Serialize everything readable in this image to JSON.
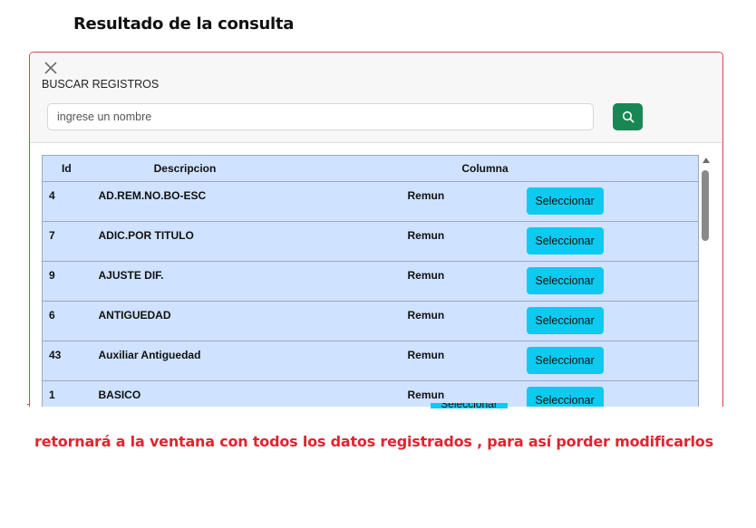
{
  "page": {
    "heading": "Resultado de la consulta",
    "footer_note": "retornará a la ventana con todos los datos registrados , para así porder modificarlos"
  },
  "modal": {
    "title": "BUSCAR REGISTROS",
    "close_icon": "close-icon",
    "search": {
      "value": "",
      "placeholder": "ingrese un nombre",
      "button_icon": "search-icon"
    },
    "table": {
      "columns": [
        "Id",
        "Descripcion",
        "Columna",
        ""
      ],
      "rows": [
        {
          "id": "4",
          "descripcion": "AD.REM.NO.BO-ESC",
          "columna": "Remun",
          "action": "Seleccionar"
        },
        {
          "id": "7",
          "descripcion": "ADIC.POR TITULO",
          "columna": "Remun",
          "action": "Seleccionar"
        },
        {
          "id": "9",
          "descripcion": "AJUSTE DIF.",
          "columna": "Remun",
          "action": "Seleccionar"
        },
        {
          "id": "6",
          "descripcion": "ANTIGUEDAD",
          "columna": "Remun",
          "action": "Seleccionar"
        },
        {
          "id": "43",
          "descripcion": "Auxiliar Antiguedad",
          "columna": "Remun",
          "action": "Seleccionar"
        },
        {
          "id": "1",
          "descripcion": "BASICO",
          "columna": "Remun",
          "action": "Seleccionar"
        }
      ]
    },
    "ghost_button_label": "Seleccionar"
  },
  "colors": {
    "modal_border": "#d4444c",
    "table_bg": "#cfe2ff",
    "select_button": "#0dcaf0",
    "search_button": "#198754",
    "footer_text": "#e0242f"
  }
}
